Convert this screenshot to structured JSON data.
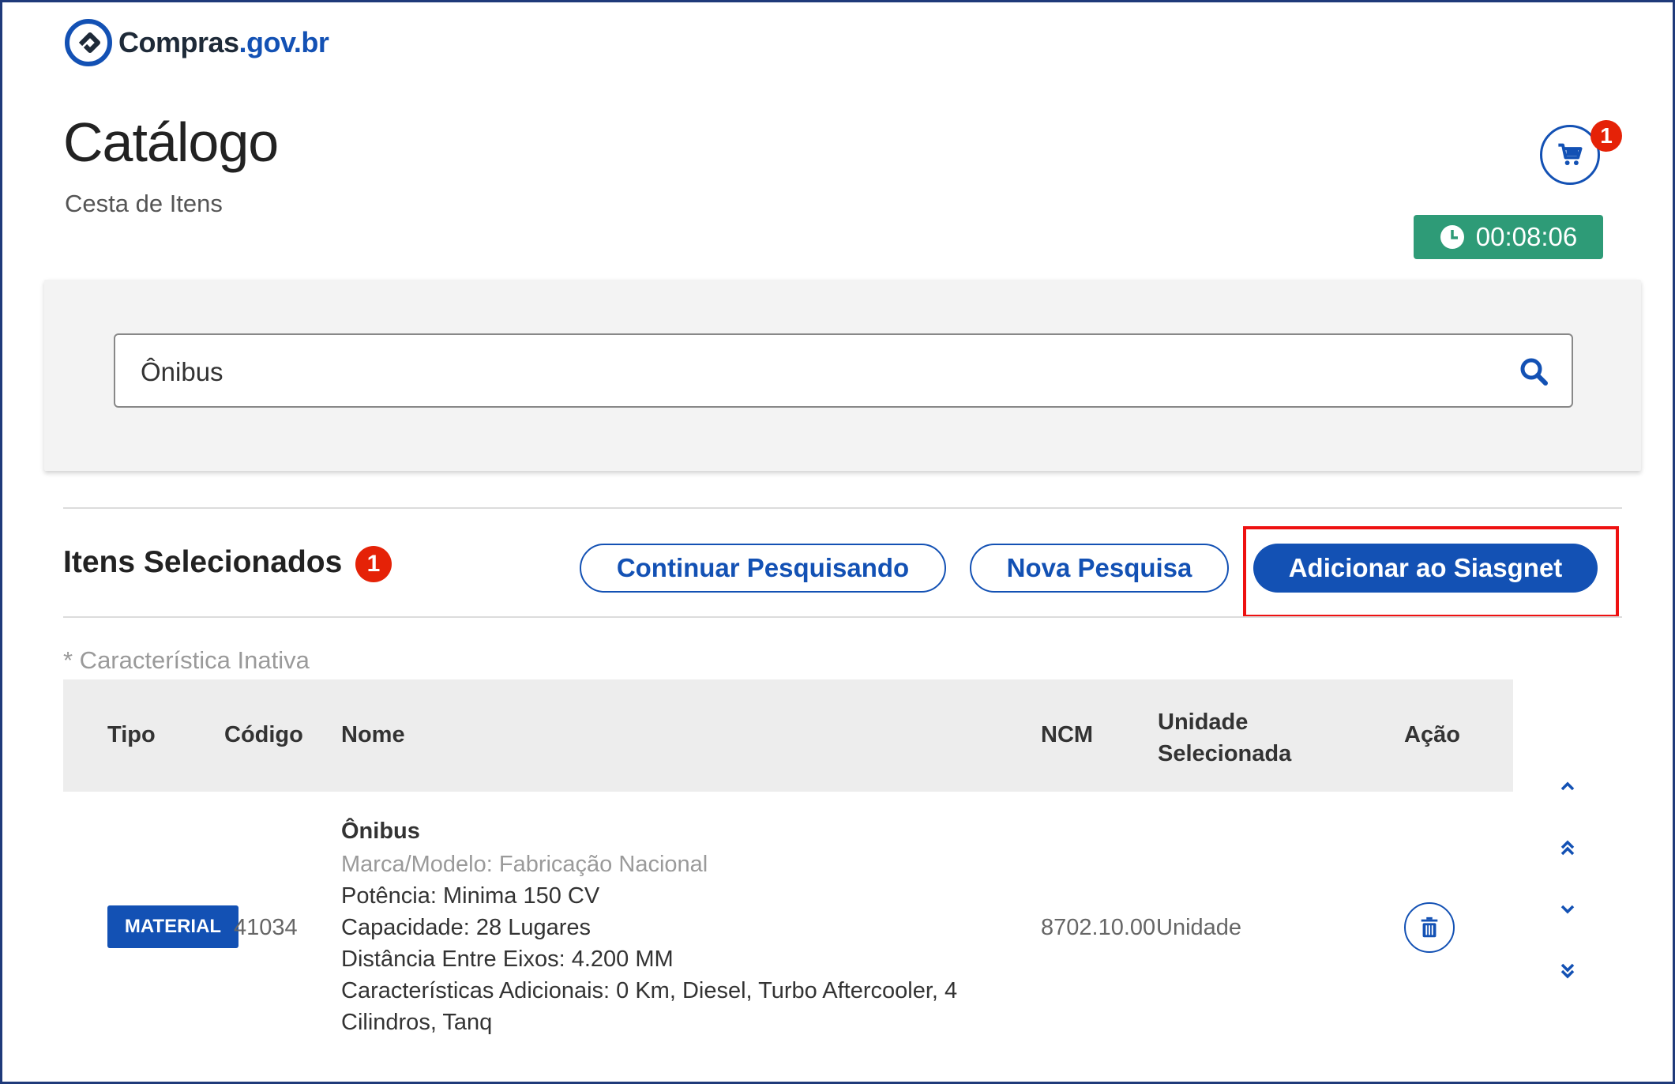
{
  "brand": {
    "name_main": "Compras",
    "name_domain": ".gov.br"
  },
  "header": {
    "title": "Catálogo",
    "subtitle": "Cesta de Itens",
    "cart_count": "1",
    "timer": "00:08:06"
  },
  "search": {
    "value": "Ônibus"
  },
  "selected": {
    "title": "Itens Selecionados",
    "count": "1",
    "btn_continue": "Continuar Pesquisando",
    "btn_new": "Nova Pesquisa",
    "btn_add": "Adicionar ao Siasgnet"
  },
  "note": "* Característica Inativa",
  "table": {
    "headers": {
      "tipo": "Tipo",
      "codigo": "Código",
      "nome": "Nome",
      "ncm": "NCM",
      "unidade_l1": "Unidade",
      "unidade_l2": "Selecionada",
      "acao": "Ação"
    },
    "row": {
      "tipo": "MATERIAL",
      "codigo": "41034",
      "nome": "Ônibus",
      "marca": "Marca/Modelo: Fabricação Nacional",
      "potencia": "Potência: Minima 150 CV",
      "capacidade": "Capacidade: 28 Lugares",
      "distancia": "Distância Entre Eixos: 4.200 MM",
      "caracteristicas_l1": "Características Adicionais: 0 Km, Diesel, Turbo Aftercooler, 4",
      "caracteristicas_l2": "Cilindros, Tanq",
      "ncm": "8702.10.00",
      "unidade": "Unidade"
    }
  },
  "colors": {
    "primary": "#1351b4",
    "danger": "#e52207",
    "timer": "#2e9b77",
    "highlight": "#ee1111"
  }
}
